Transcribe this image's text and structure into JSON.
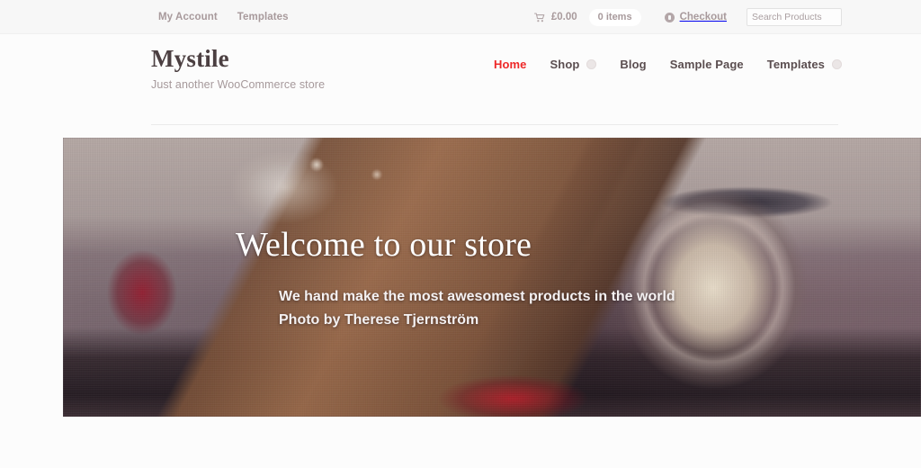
{
  "topbar": {
    "links": [
      {
        "label": "My Account",
        "name": "my-account"
      },
      {
        "label": "Templates",
        "name": "templates"
      }
    ],
    "cart": {
      "icon": "shopping-cart-icon",
      "total": "£0.00",
      "items_badge": "0 items"
    },
    "checkout": {
      "icon": "checkout-icon",
      "label": "Checkout"
    },
    "search": {
      "placeholder": "Search Products",
      "value": ""
    }
  },
  "header": {
    "brand_title": "Mystile",
    "brand_tagline": "Just another WooCommerce store",
    "nav": [
      {
        "label": "Home",
        "active": true,
        "caret": false
      },
      {
        "label": "Shop",
        "active": false,
        "caret": true
      },
      {
        "label": "Blog",
        "active": false,
        "caret": false
      },
      {
        "label": "Sample Page",
        "active": false,
        "caret": false
      },
      {
        "label": "Templates",
        "active": false,
        "caret": true
      }
    ]
  },
  "hero": {
    "title": "Welcome to our store",
    "subtitle": "We hand make the most awesomest products in the world",
    "credit": "Photo by Therese Tjernström"
  },
  "colors": {
    "accent_active": "#ee2828",
    "muted_text": "#a89a9c",
    "nav_text": "#5b4e50",
    "brand_text": "#4b3f41",
    "page_bg": "#fcfcfc",
    "topbar_bg": "#f7f7f7",
    "hero_text": "#ffffff"
  }
}
